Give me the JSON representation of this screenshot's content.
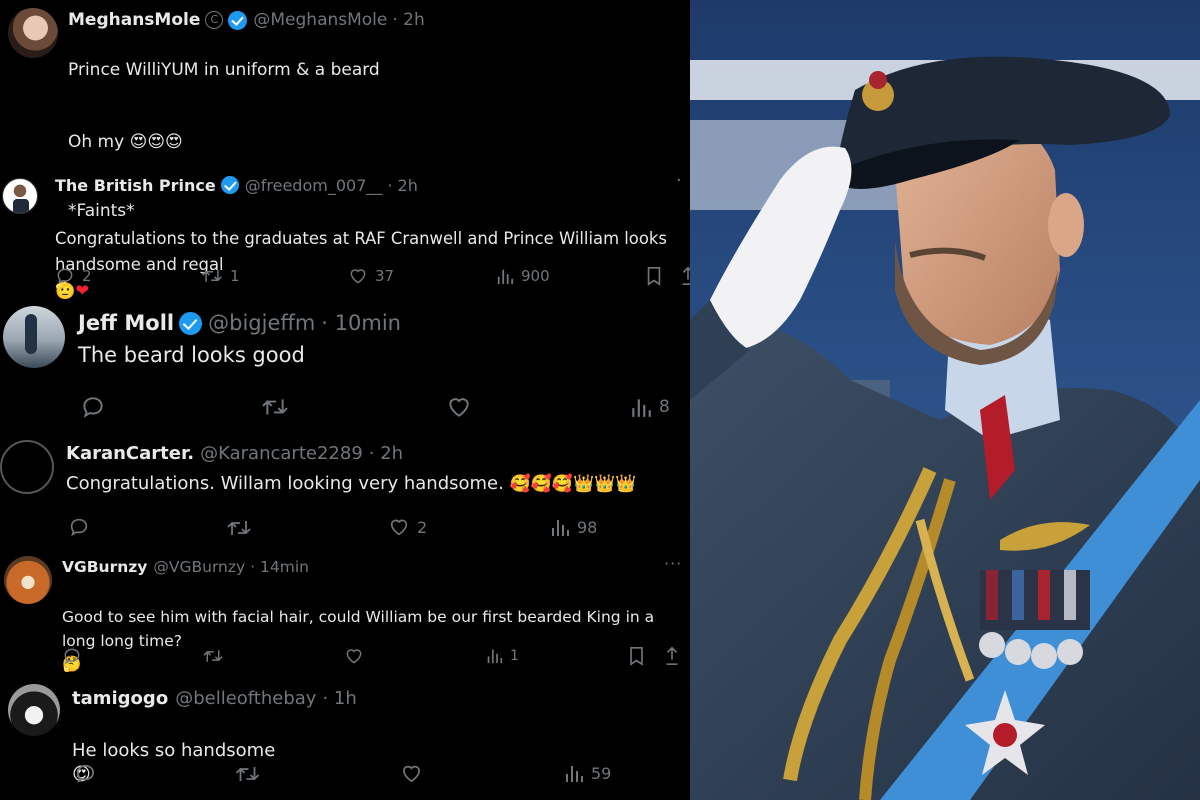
{
  "tweets": [
    {
      "name": "MeghansMole",
      "handle": "@MeghansMole",
      "time": "· 2h",
      "lines": [
        "Prince WilliYUM in uniform & a beard",
        "Oh my",
        "*Faints*"
      ]
    },
    {
      "name": "The British Prince",
      "handle": "@freedom_007__",
      "time": "· 2h",
      "text": "Congratulations to the graduates at RAF Cranwell and Prince William looks handsome and regal",
      "replies": "2",
      "reposts": "1",
      "likes": "37",
      "views": "900"
    },
    {
      "name": "Jeff Moll",
      "handle": "@bigjeffm",
      "time": "· 10min",
      "text": "The beard looks good",
      "views": "8"
    },
    {
      "name": "KaranCarter.",
      "handle": "@Karancarte2289",
      "time": "· 2h",
      "text": "Congratulations. Willam looking very handsome.",
      "likes": "2",
      "views": "98"
    },
    {
      "name": "VGBurnzy",
      "handle": "@VGBurnzy",
      "time": "· 14min",
      "text": "Good to see him with facial hair, could William be our first bearded King in a long long time?",
      "views": "1"
    },
    {
      "name": "tamigogo",
      "handle": "@belleofthebay",
      "time": "· 1h",
      "text": "He looks so handsome",
      "views": "59"
    }
  ],
  "colors": {
    "verified": "#1d9bf0",
    "muted": "#71767b",
    "text": "#e7e9ea",
    "heart": "#f4212e"
  }
}
